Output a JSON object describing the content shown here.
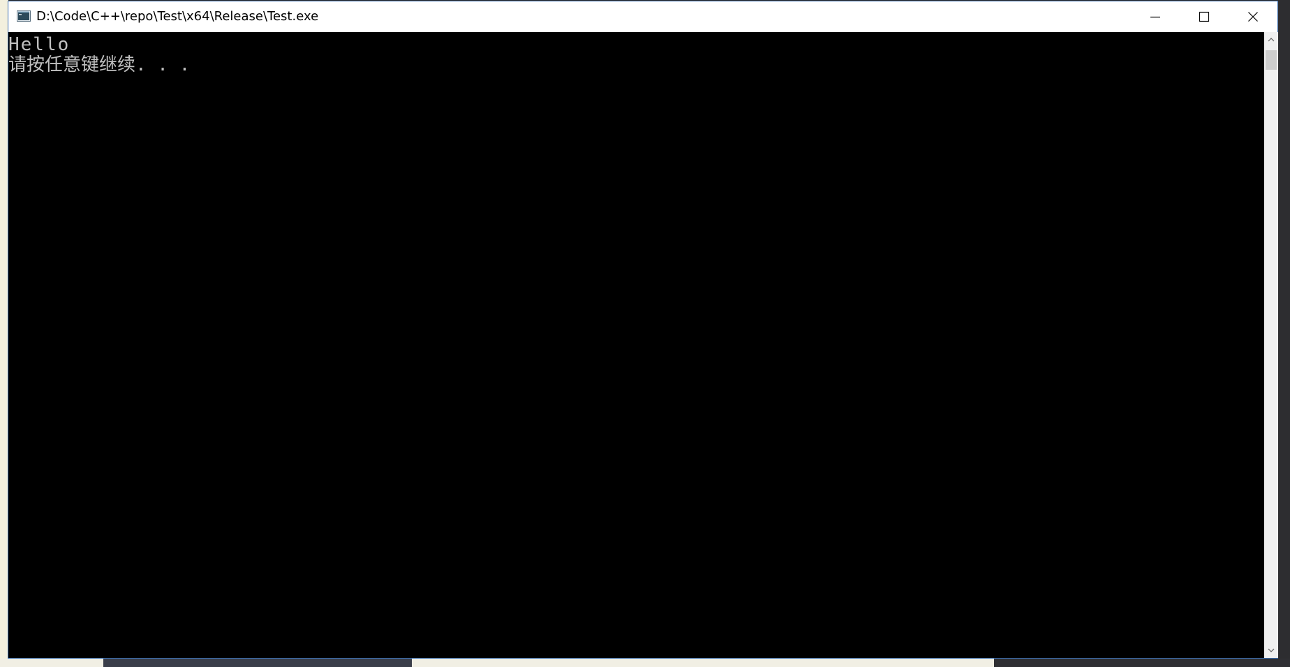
{
  "window": {
    "title": "D:\\Code\\C++\\repo\\Test\\x64\\Release\\Test.exe"
  },
  "console": {
    "lines": [
      "Hello",
      "请按任意键继续. . ."
    ]
  },
  "icons": {
    "app": "console-app-icon",
    "minimize": "minimize-icon",
    "maximize": "maximize-icon",
    "close": "close-icon",
    "scroll_up": "chevron-up-icon",
    "scroll_down": "chevron-down-icon"
  },
  "colors": {
    "console_bg": "#000000",
    "console_text": "#c0c0c0",
    "titlebar_bg": "#ffffff",
    "window_border": "#3c6fb0"
  }
}
